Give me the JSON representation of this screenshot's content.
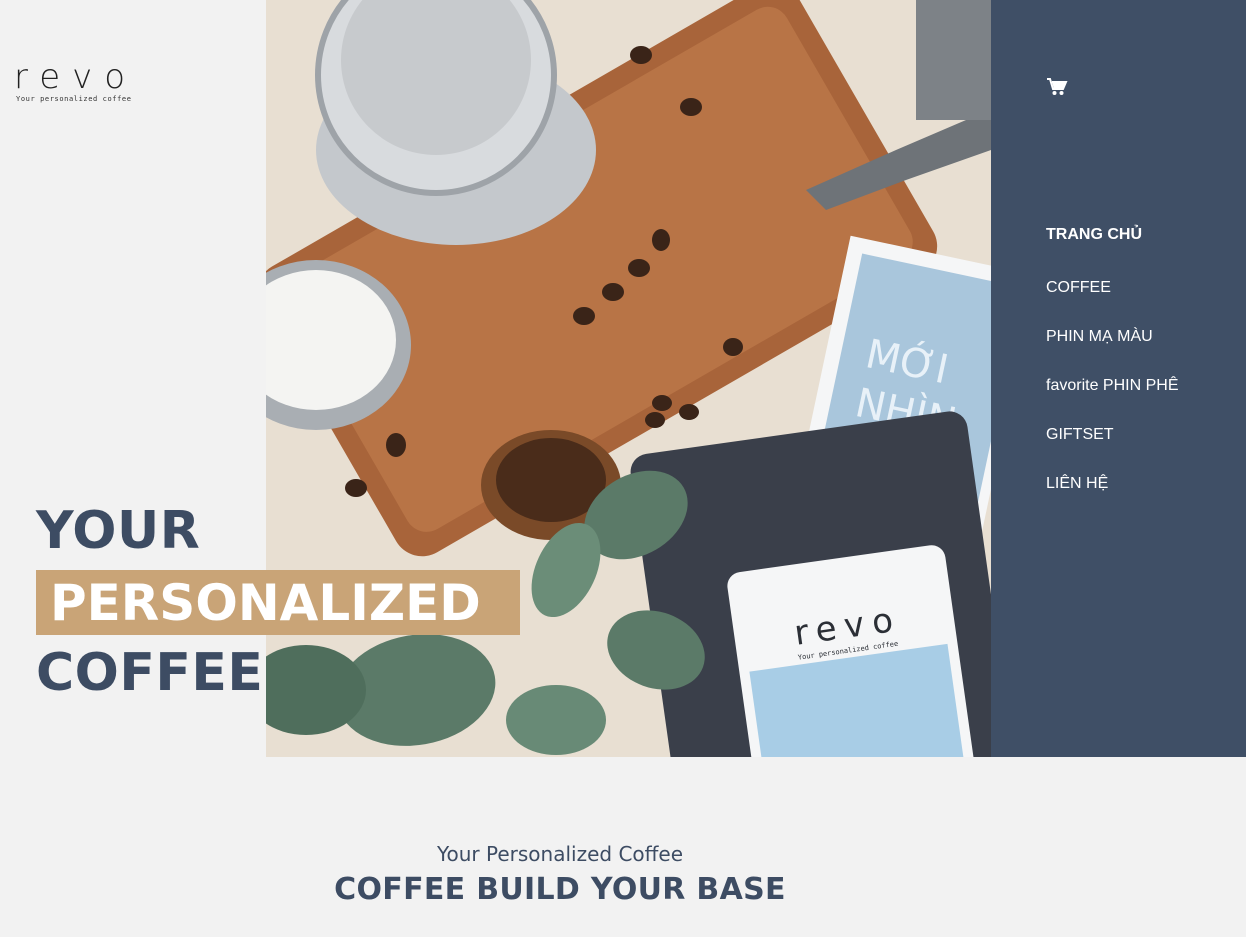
{
  "logo": {
    "wordmark": "revo",
    "tagline": "Your personalized coffee"
  },
  "nav": {
    "cart_icon": "shopping-cart-icon",
    "items": [
      {
        "label": "TRANG CHỦ",
        "active": true
      },
      {
        "label": "COFFEE",
        "active": false
      },
      {
        "label": "PHIN MẠ MÀU",
        "active": false
      },
      {
        "label": "favorite PHIN PHÊ",
        "active": false
      },
      {
        "label": "GIFTSET",
        "active": false
      },
      {
        "label": "LIÊN HỆ",
        "active": false
      }
    ]
  },
  "hero": {
    "line1": "YOUR",
    "line2": "PERSONALIZED",
    "line3": "COFFEE",
    "image": {
      "package_brand": "revo",
      "package_tagline": "Your personalized coffee",
      "book_title_line1": "MỚI",
      "book_title_line2": "NHÌN"
    }
  },
  "section": {
    "subtitle": "Your Personalized Coffee",
    "title": "COFFEE BUILD YOUR BASE"
  },
  "colors": {
    "nav_bg": "#3f4f66",
    "accent": "#c9a477",
    "heading": "#3d4c63",
    "page_bg": "#f2f2f2"
  }
}
